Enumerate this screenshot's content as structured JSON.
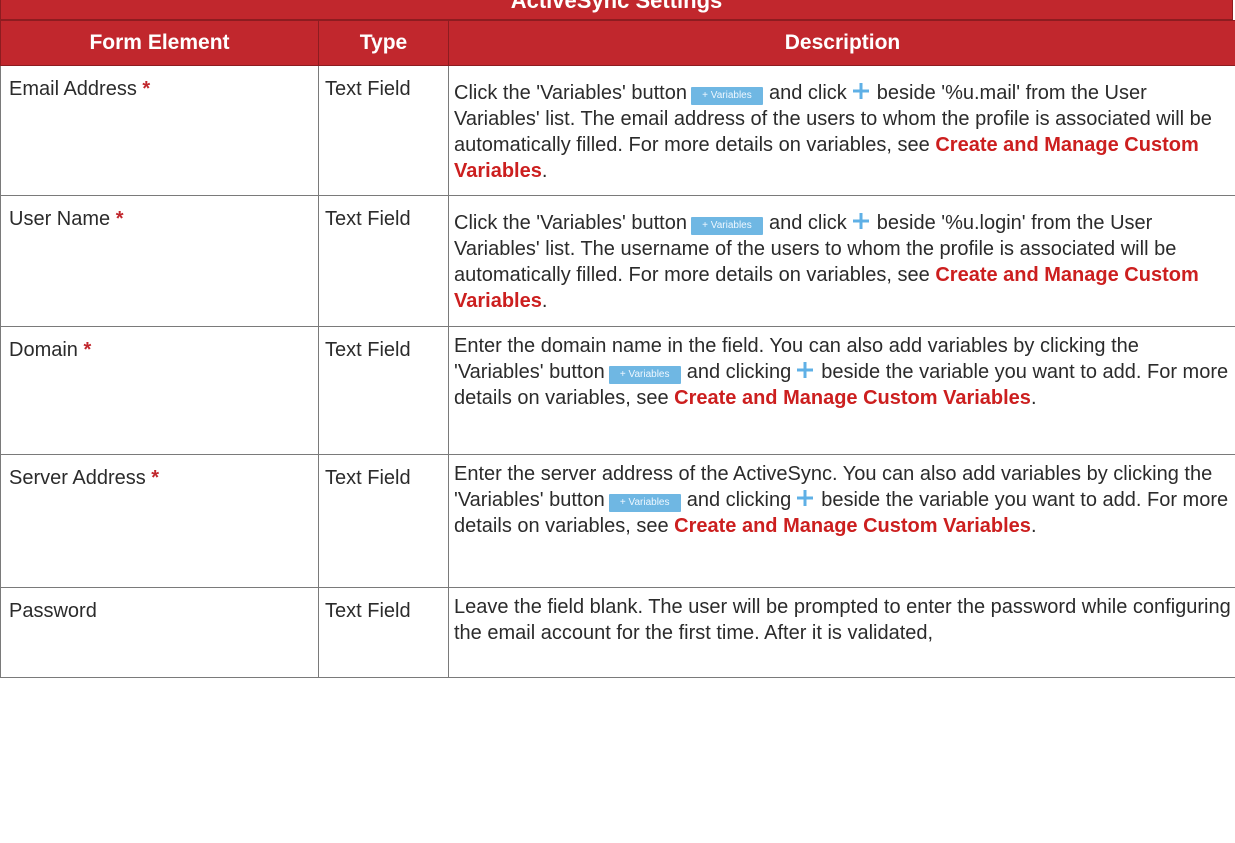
{
  "page_title": "ActiveSync Settings",
  "columns": [
    "Form Element",
    "Type",
    "Description"
  ],
  "variables_button_label": "+ Variables",
  "link_text": "Create and Manage Custom Variables",
  "colors": {
    "header_bg": "#c1272d",
    "required_star": "#c1272d",
    "link": "#cc1f1f",
    "variables_button": "#6fb7e3",
    "plus_icon": "#5fb0e6"
  },
  "rows": [
    {
      "element": "Email Address",
      "required": "*",
      "type": "Text Field",
      "d1": "Click the 'Variables' button",
      "d2": "and click",
      "d3": "beside '%u.mail' from the User Variables' list. The email address of the users to whom the profile is associated will be automatically filled. For more details on variables, see",
      "end": "."
    },
    {
      "element": "User Name",
      "required": "*",
      "type": "Text Field",
      "d1": "Click the 'Variables' button",
      "d2": "and click",
      "d3": "beside '%u.login' from the User Variables' list. The username of the users to whom the profile is associated will be automatically filled. For more details on variables, see",
      "end": "."
    },
    {
      "element": "Domain",
      "required": "*",
      "type": "Text Field",
      "d1": "Enter the domain name in the field. You can also add variables by clicking the 'Variables' button",
      "d2": "and clicking",
      "d3": "beside the variable you want to add. For more details on variables, see",
      "end": "."
    },
    {
      "element": "Server Address",
      "required": "*",
      "type": "Text Field",
      "d1": "Enter the server address of the ActiveSync. You can also add variables by clicking the 'Variables' button",
      "d2": "and clicking",
      "d3": "beside the variable you want to add. For more details on variables, see",
      "end": "."
    },
    {
      "element": "Password",
      "type": "Text Field",
      "d1": "Leave the field blank. The user will be prompted to enter the password while configuring the email account for the first time. After it is validated,"
    }
  ]
}
